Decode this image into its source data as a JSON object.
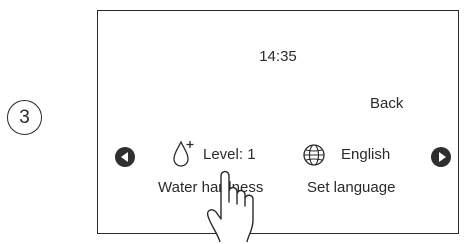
{
  "step": {
    "number": "3"
  },
  "screen": {
    "time": "14:35",
    "back_label": "Back",
    "water_hardness": {
      "value": "Level: 1",
      "label": "Water hardness"
    },
    "language": {
      "value": "English",
      "label": "Set language"
    }
  },
  "icons": {
    "left_arrow": "left-arrow-icon",
    "right_arrow": "right-arrow-icon",
    "water_drop": "water-drop-icon",
    "globe": "globe-icon",
    "hand": "hand-pointer-icon"
  }
}
